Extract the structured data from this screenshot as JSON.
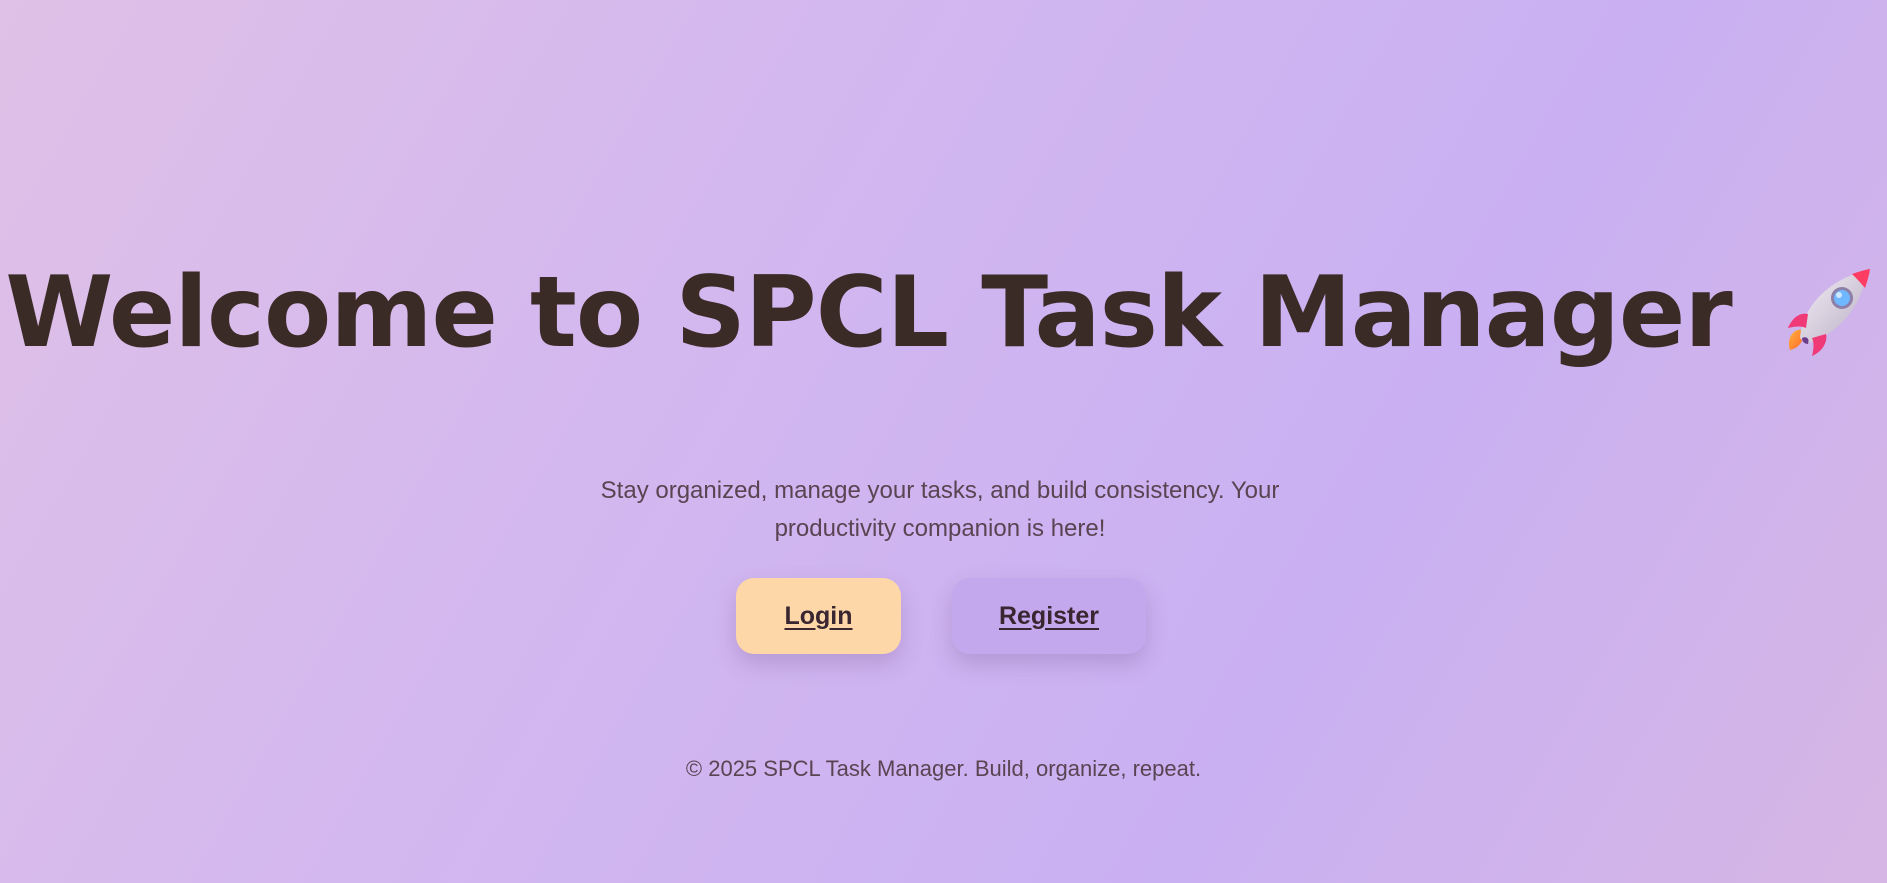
{
  "hero": {
    "title": "Welcome to SPCL Task Manager",
    "emoji_icon": "rocket-icon"
  },
  "subtitle": "Stay organized, manage your tasks, and build consistency. Your productivity companion is here!",
  "actions": {
    "login_label": "Login",
    "register_label": "Register"
  },
  "footer": {
    "text": "© 2025 SPCL Task Manager. Build, organize, repeat."
  },
  "colors": {
    "background_start": "#dfc0e6",
    "background_end": "#c9b0f2",
    "title": "#3b2b27",
    "login_button": "#fdd7a8",
    "register_button": "#c3a8ee"
  }
}
